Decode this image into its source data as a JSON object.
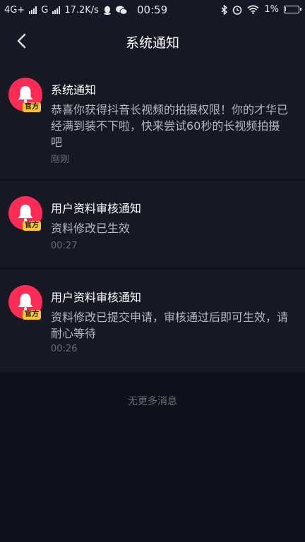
{
  "status_bar": {
    "network_left": "4G+",
    "network_mid": "G",
    "speed": "17.2K/s",
    "time": "00:59",
    "battery_percent": "1%",
    "battery_level": 0.01,
    "icons": [
      "signal-icon",
      "qq-icon",
      "wechat-icon",
      "bluetooth-icon",
      "alarm-icon",
      "wifi-icon",
      "battery-icon"
    ]
  },
  "header": {
    "title": "系统通知",
    "back_icon": "chevron-left-icon"
  },
  "notifications": [
    {
      "title": "系统通知",
      "badge": "官方",
      "body": "恭喜你获得抖音长视频的拍摄权限！你的才华已经满到装不下啦，快来尝试60秒的长视频拍摄吧",
      "time": "刚刚",
      "icon": "bell-icon"
    },
    {
      "title": "用户资料审核通知",
      "badge": "官方",
      "body": "资料修改已生效",
      "time": "00:27",
      "icon": "bell-icon"
    },
    {
      "title": "用户资料审核通知",
      "badge": "官方",
      "body": "资料修改已提交申请，审核通过后即可生效，请耐心等待",
      "time": "00:26",
      "icon": "bell-icon"
    }
  ],
  "footer": {
    "no_more": "无更多消息"
  },
  "colors": {
    "background": "#0f121b",
    "card": "#161823",
    "avatar": "#fe2c55",
    "badge": "#f7c531"
  }
}
